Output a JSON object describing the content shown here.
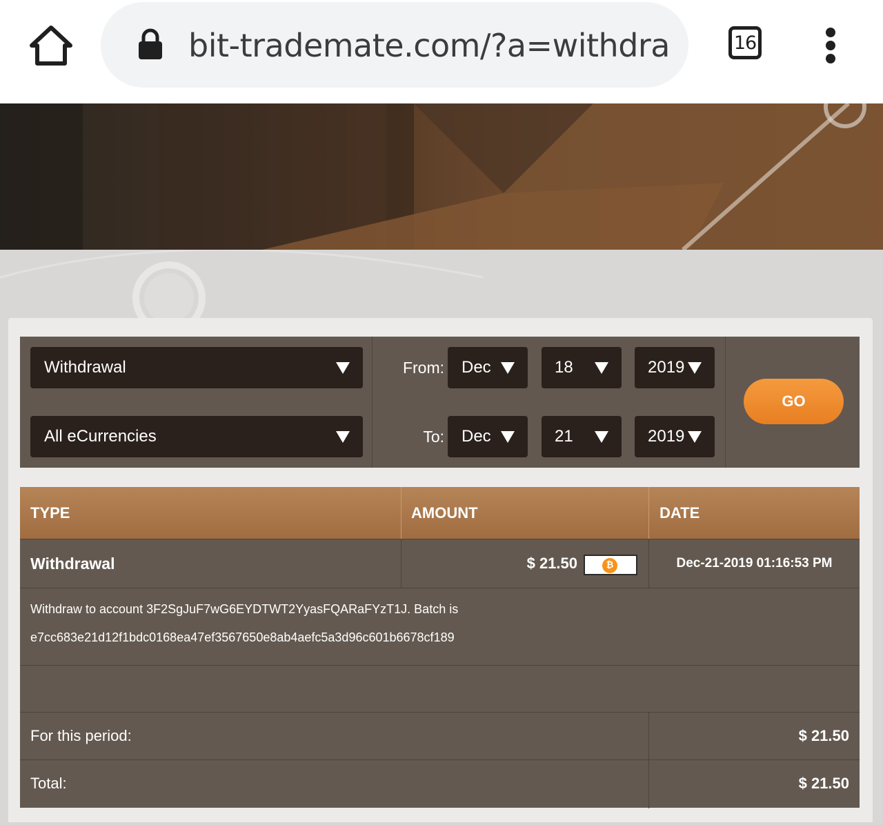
{
  "browser": {
    "url": "bit-trademate.com/?a=withdraw_",
    "tab_count": "16",
    "icons": [
      "home-icon",
      "lock-icon",
      "tab-switcher-icon",
      "more-vert-icon"
    ]
  },
  "filters": {
    "type_select": "Withdrawal",
    "currency_select": "All eCurrencies",
    "from_label": "From:",
    "to_label": "To:",
    "from": {
      "month": "Dec",
      "day": "18",
      "year": "2019"
    },
    "to": {
      "month": "Dec",
      "day": "21",
      "year": "2019"
    },
    "go_label": "GO"
  },
  "table": {
    "headers": {
      "type": "TYPE",
      "amount": "AMOUNT",
      "date": "DATE"
    },
    "row": {
      "type": "Withdrawal",
      "amount": "$ 21.50",
      "currency_icon": "bitcoin-icon",
      "date": "Dec-21-2019 01:16:53 PM",
      "detail_line1": "Withdraw to account 3F2SgJuF7wG6EYDTWT2YyasFQARaFYzT1J. Batch is",
      "detail_line2": "e7cc683e21d12f1bdc0168ea47ef3567650e8ab4aefc5a3d96c601b6678cf189"
    },
    "period_label": "For this period:",
    "period_value": "$ 21.50",
    "total_label": "Total:",
    "total_value": "$ 21.50"
  },
  "colors": {
    "accent": "#e87f22",
    "header": "#a97646",
    "table_bg": "#635950",
    "bitcoin": "#f7931a"
  }
}
